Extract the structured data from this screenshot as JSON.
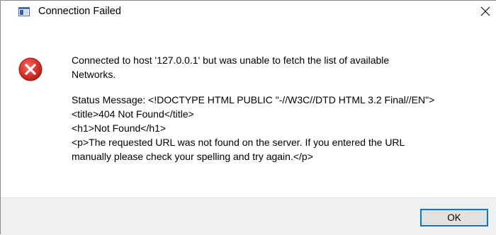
{
  "window": {
    "title": "Connection Failed",
    "icon": "window-app-icon",
    "close_icon": "close-icon"
  },
  "message": {
    "icon": "error-icon",
    "line1": "Connected to host '127.0.0.1' but was unable to fetch the list of available",
    "line2": "Networks.",
    "status_line1": "Status Message: <!DOCTYPE HTML PUBLIC \"-//W3C//DTD HTML 3.2 Final//EN\">",
    "status_line2": "<title>404 Not Found</title>",
    "status_line3": "<h1>Not Found</h1>",
    "status_line4": "<p>The requested URL was not found on the server. If you entered the URL",
    "status_line5": "manually please check your spelling and try again.</p>"
  },
  "buttons": {
    "ok_label": "OK"
  },
  "colors": {
    "error_red": "#d9312b",
    "accent_blue": "#0078d7",
    "footer_bg": "#f0f0f0"
  }
}
